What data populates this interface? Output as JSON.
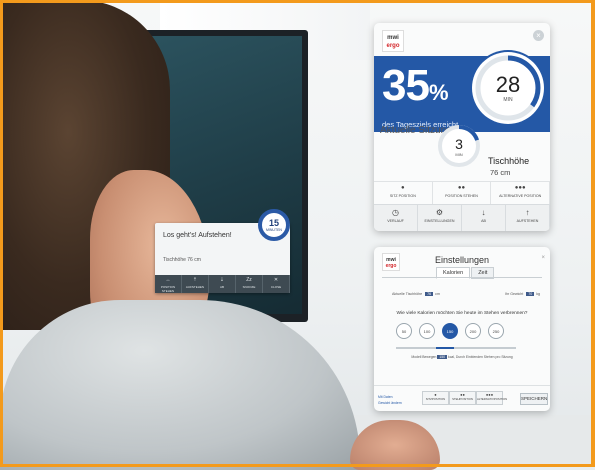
{
  "monitor_notification": {
    "message": "Los geht's! Aufstehen!",
    "height_label": "Tischhöhe 76 cm",
    "badge_value": "15",
    "badge_unit": "MINUTEN",
    "actions": [
      {
        "icon": "move-icon",
        "glyph": "↔",
        "label": "POSITION STEHEN"
      },
      {
        "icon": "up-arrow-icon",
        "glyph": "⇡",
        "label": "AUFSTEHEN"
      },
      {
        "icon": "down-arrow-icon",
        "glyph": "⇣",
        "label": "AB"
      },
      {
        "icon": "snooze-icon",
        "glyph": "Zz",
        "label": "SNOOZE"
      },
      {
        "icon": "close-icon",
        "glyph": "✕",
        "label": "CLOSE"
      }
    ]
  },
  "widget_main": {
    "logo_top": "mwi",
    "logo_bottom": "ergo",
    "close_glyph": "×",
    "percent_value": "35",
    "percent_sign": "%",
    "percent_caption": "des Tagesziels erreicht",
    "goal_ring_value": "28",
    "goal_ring_unit": "MIN",
    "goal_progress": 0.35,
    "session_label": "Aktuelle Sitzung",
    "session_value": "3",
    "session_unit": "MIN",
    "session_progress": 0.2,
    "desk_height_label": "Tischhöhe",
    "desk_height_value": "76 cm",
    "positions": [
      {
        "glyph": "●",
        "label": "SITZ POSITION"
      },
      {
        "glyph": "●●",
        "label": "POSITION STEHEN"
      },
      {
        "glyph": "●●●",
        "label": "ALTERNATIVE POSITION"
      }
    ],
    "actions": [
      {
        "glyph": "◷",
        "label": "VERLAUF"
      },
      {
        "glyph": "⚙",
        "label": "EINSTELLUNGEN"
      },
      {
        "glyph": "↓",
        "label": "AB"
      },
      {
        "glyph": "↑",
        "label": "AUFSTEHEN"
      }
    ],
    "accent_color": "#2458a6"
  },
  "widget_settings": {
    "logo_top": "mwi",
    "logo_bottom": "ergo",
    "title": "Einstellungen",
    "close_glyph": "×",
    "tabs": [
      "Kalorien",
      "Zeit"
    ],
    "current_height_label": "Aktuelle Tischhöhe",
    "current_height_value": "76",
    "current_height_unit": "cm",
    "weight_label": "Ihr Gewicht",
    "weight_value": "70",
    "weight_unit": "kg",
    "question": "Wie viele Kalorien möchten Sie heute im Stehen verbrennen?",
    "options": [
      "50",
      "100",
      "150",
      "200",
      "250"
    ],
    "selected_option": "150",
    "recommendation_prefix": "Modell Bewegen",
    "recommendation_value": "150",
    "recommendation_suffix": "kcal, Durch Einblenden Stehen pro Sitzung",
    "links": [
      "Mit Daten",
      "Gewicht ändern"
    ],
    "footer_buttons": [
      {
        "glyph": "●",
        "label": "SITZPOSITION"
      },
      {
        "glyph": "●●",
        "label": "STEHPOSITION"
      },
      {
        "glyph": "●●●",
        "label": "ALTERNATIVPOSITION"
      }
    ],
    "save_label": "SPEICHERN"
  }
}
